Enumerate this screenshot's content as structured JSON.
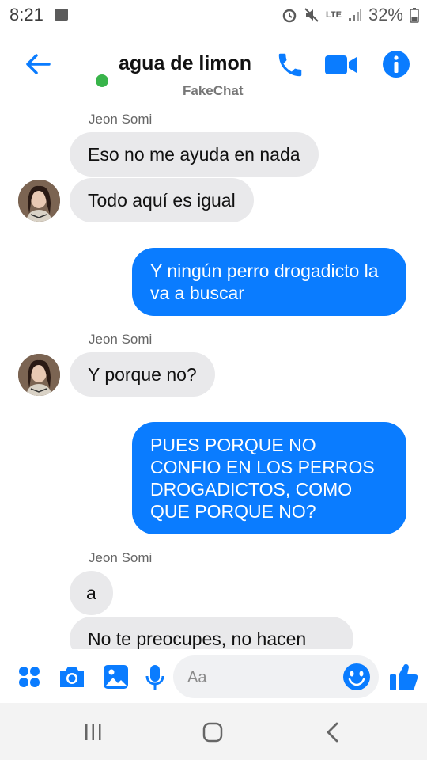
{
  "status": {
    "time": "8:21",
    "network": "LTE",
    "battery": "32%"
  },
  "header": {
    "title": "agua de limon",
    "subtitle": "FakeChat"
  },
  "messages": [
    {
      "sender": "Jeon Somi"
    },
    {
      "text": "Eso no me ayuda en nada"
    },
    {
      "text": "Todo aquí es igual"
    },
    {
      "text": "Y ningún perro drogadicto la va a buscar"
    },
    {
      "sender": "Jeon Somi"
    },
    {
      "text": "Y porque no?"
    },
    {
      "text": "PUES PORQUE NO CONFIO EN LOS PERROS DROGADICTOS, COMO QUE PORQUE NO?"
    },
    {
      "sender": "Jeon Somi"
    },
    {
      "text": "a"
    },
    {
      "text": "No te preocupes, no hacen"
    }
  ],
  "composer": {
    "placeholder": "Aa"
  },
  "colors": {
    "accent": "#0a7cff",
    "incoming_bubble": "#e9e9eb",
    "online": "#38b44a"
  }
}
